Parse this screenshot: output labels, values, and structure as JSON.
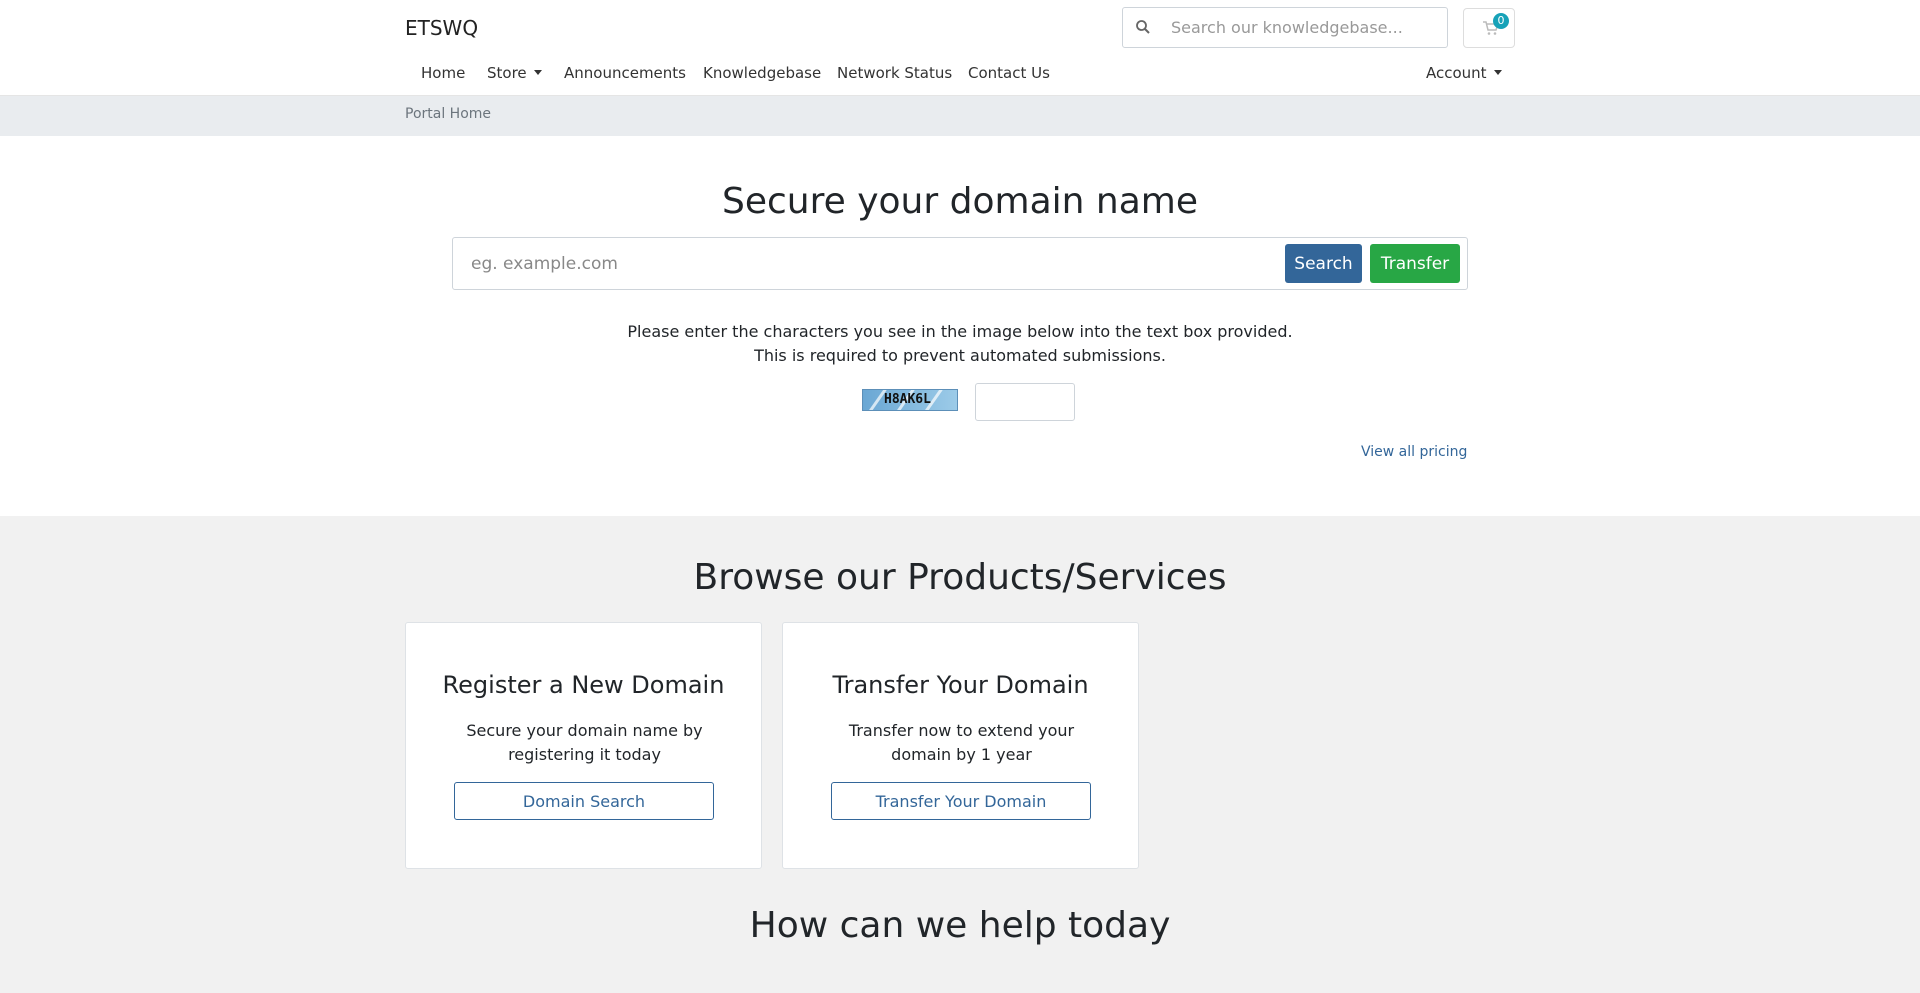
{
  "header": {
    "brand": "ETSWQ",
    "search_placeholder": "Search our knowledgebase...",
    "cart_count": "0"
  },
  "nav": {
    "home": "Home",
    "store": "Store",
    "announcements": "Announcements",
    "knowledgebase": "Knowledgebase",
    "network_status": "Network Status",
    "contact_us": "Contact Us",
    "account": "Account"
  },
  "breadcrumb": {
    "current": "Portal Home"
  },
  "hero": {
    "title": "Secure your domain name",
    "domain_placeholder": "eg. example.com",
    "search_button": "Search",
    "transfer_button": "Transfer",
    "captcha_instructions": "Please enter the characters you see in the image below into the text box provided. This is required to prevent automated submissions.",
    "captcha_code": "H8AK6L",
    "view_pricing": "View all pricing"
  },
  "browse": {
    "title": "Browse our Products/Services",
    "cards": [
      {
        "title": "Register a New Domain",
        "description": "Secure your domain name by registering it today",
        "button": "Domain Search"
      },
      {
        "title": "Transfer Your Domain",
        "description": "Transfer now to extend your domain by 1 year",
        "button": "Transfer Your Domain"
      }
    ]
  },
  "help": {
    "title": "How can we help today"
  },
  "colors": {
    "primary": "#336699",
    "success": "#28a745",
    "badge": "#17a2b8"
  }
}
